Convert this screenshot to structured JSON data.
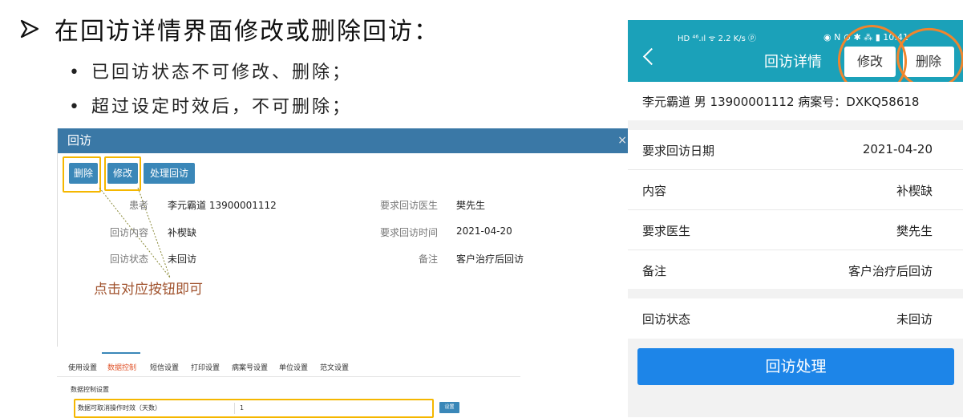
{
  "slide": {
    "title": "在回访详情界面修改或删除回访：",
    "bullets": [
      "已回访状态不可修改、删除；",
      "超过设定时效后，不可删除；"
    ]
  },
  "dialog": {
    "title": "回访",
    "close_glyph": "×",
    "buttons": {
      "delete": "删除",
      "edit": "修改",
      "process": "处理回访"
    },
    "fields": {
      "patient_label": "患者",
      "patient_value": "李元霸道 13900001112",
      "doctor_label": "要求回访医生",
      "doctor_value": "樊先生",
      "content_label": "回访内容",
      "content_value": "补楔缺",
      "time_label": "要求回访时间",
      "time_value": "2021-04-20",
      "status_label": "回访状态",
      "status_value": "未回访",
      "remark_label": "备注",
      "remark_value": "客户治疗后回访"
    },
    "annotation": "点击对应按钮即可"
  },
  "settings": {
    "tabs": [
      "使用设置",
      "数据控制",
      "短信设置",
      "打印设置",
      "病案号设置",
      "单位设置",
      "范文设置"
    ],
    "active_tab": "数据控制",
    "section_title": "数据控制设置",
    "row_label": "数据可取消操作时效（天数）",
    "row_value": "1",
    "save_button": "设置"
  },
  "phone": {
    "status_left": "HD ⁴⁶.ıl ᯤ 2.2 K/s ⓟ",
    "status_right": "◉ N ⊙ ✱ ⁂ ▮ 10:41",
    "header_title": "回访详情",
    "edit_button": "修改",
    "delete_button": "删除",
    "patient_info": "李元霸道  男 13900001112   病案号：DXKQ58618",
    "rows": [
      {
        "label": "要求回访日期",
        "value": "2021-04-20"
      },
      {
        "label": "内容",
        "value": "补楔缺"
      },
      {
        "label": "要求医生",
        "value": "樊先生"
      },
      {
        "label": "备注",
        "value": "客户治疗后回访"
      }
    ],
    "status_row": {
      "label": "回访状态",
      "value": "未回访"
    },
    "action_button": "回访处理"
  },
  "colors": {
    "dialog_header": "#3a78a6",
    "button_blue": "#3a87b8",
    "highlight_yellow": "#f5b700",
    "phone_header": "#1ba1b9",
    "circle_orange": "#f0852d",
    "primary_button": "#1d85e8",
    "annotation_text": "#a0522d"
  }
}
